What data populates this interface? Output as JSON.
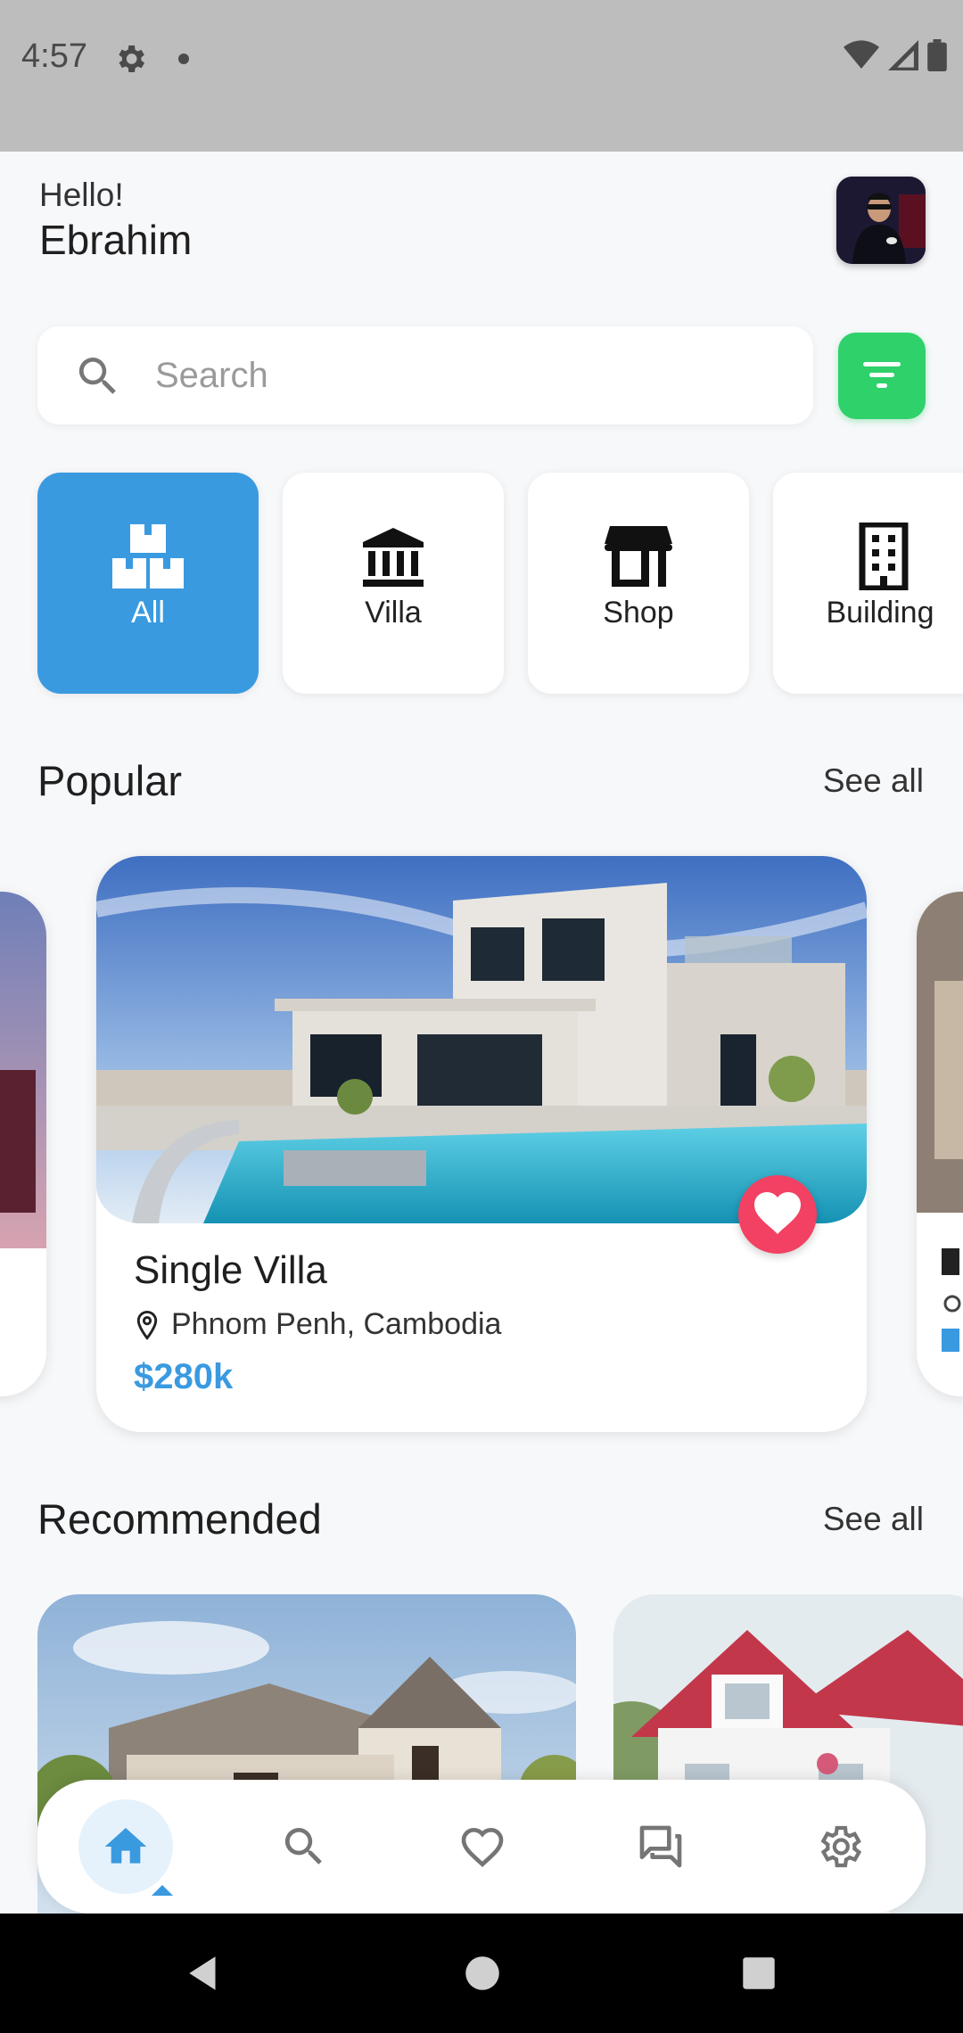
{
  "status_bar": {
    "time": "4:57"
  },
  "header": {
    "greeting": "Hello!",
    "user_name": "Ebrahim"
  },
  "search": {
    "placeholder": "Search"
  },
  "categories": [
    {
      "label": "All",
      "icon": "boxes-icon",
      "active": true
    },
    {
      "label": "Villa",
      "icon": "bank-icon",
      "active": false
    },
    {
      "label": "Shop",
      "icon": "storefront-icon",
      "active": false
    },
    {
      "label": "Building",
      "icon": "building-icon",
      "active": false
    }
  ],
  "popular": {
    "title": "Popular",
    "see_all": "See all",
    "featured": {
      "name": "Single Villa",
      "location": "Phnom Penh, Cambodia",
      "price": "$280k"
    }
  },
  "recommended": {
    "title": "Recommended",
    "see_all": "See all"
  },
  "bottom_nav": [
    {
      "icon": "home-icon",
      "active": true
    },
    {
      "icon": "search-icon",
      "active": false
    },
    {
      "icon": "heart-icon",
      "active": false
    },
    {
      "icon": "chat-icon",
      "active": false
    },
    {
      "icon": "settings-icon",
      "active": false
    }
  ],
  "colors": {
    "accent": "#3a9ae0",
    "filter": "#2fd16b",
    "favorite": "#f24162",
    "background": "#f7f8fa"
  }
}
